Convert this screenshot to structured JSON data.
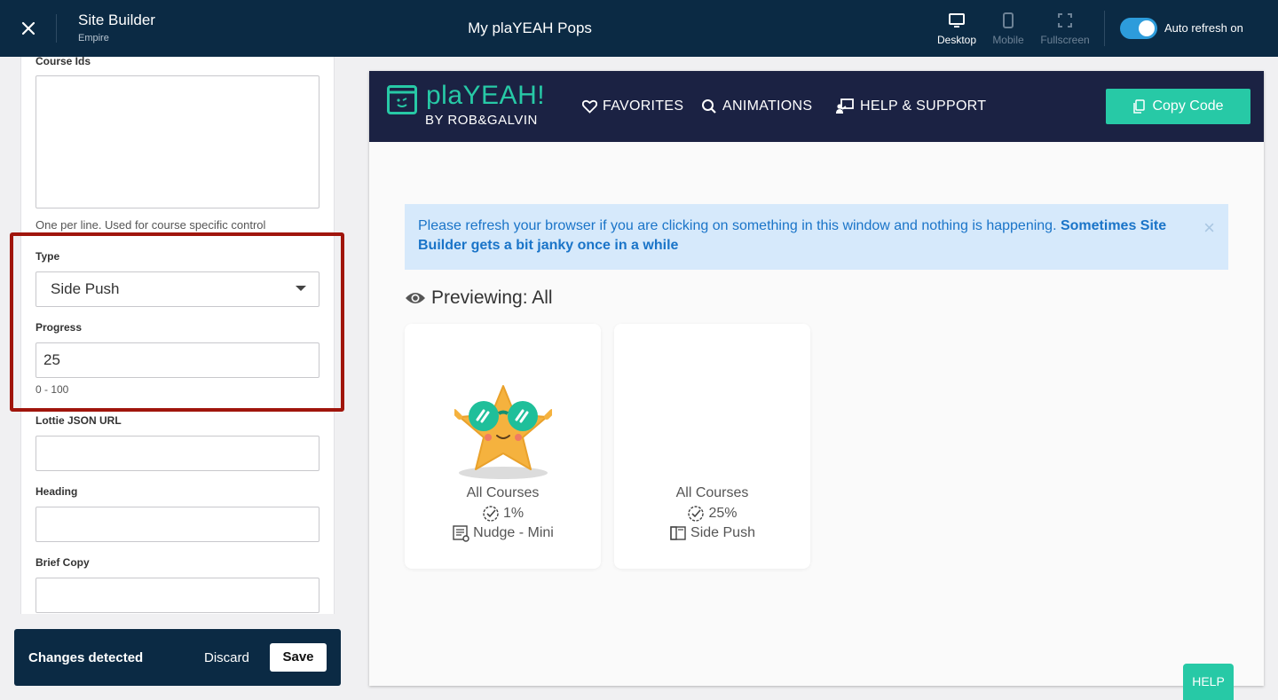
{
  "topbar": {
    "app_title": "Site Builder",
    "app_subtitle": "Empire",
    "page_name": "My plaYEAH Pops",
    "views": [
      {
        "label": "Desktop",
        "icon": "desktop-icon",
        "state": "active"
      },
      {
        "label": "Mobile",
        "icon": "mobile-icon",
        "state": "disabled"
      },
      {
        "label": "Fullscreen",
        "icon": "fullscreen-icon",
        "state": "disabled"
      }
    ],
    "auto_refresh_label": "Auto refresh on",
    "auto_refresh_on": true
  },
  "form": {
    "course_ids": {
      "label": "Course Ids",
      "value": "",
      "help": "One per line. Used for course specific control"
    },
    "type": {
      "label": "Type",
      "value": "Side Push"
    },
    "progress": {
      "label": "Progress",
      "value": "25",
      "help": "0 - 100"
    },
    "lottie": {
      "label": "Lottie JSON URL",
      "value": ""
    },
    "heading": {
      "label": "Heading",
      "value": ""
    },
    "brief_copy": {
      "label": "Brief Copy",
      "value": ""
    }
  },
  "changes_bar": {
    "text": "Changes detected",
    "discard": "Discard",
    "save": "Save"
  },
  "preview": {
    "logo_text": "plaYEAH!",
    "logo_sub": "BY ROB&GALVIN",
    "nav": [
      {
        "label": "FAVORITES",
        "icon": "heart-icon"
      },
      {
        "label": "ANIMATIONS",
        "icon": "search-icon"
      },
      {
        "label": "HELP & SUPPORT",
        "icon": "support-icon"
      }
    ],
    "copy_code": "Copy Code",
    "alert_text": "Please refresh your browser if you are clicking on something in this window and nothing is happening. ",
    "alert_bold": "Sometimes Site Builder gets a bit janky once in a while",
    "alert_close": "×",
    "previewing": "Previewing: All",
    "cards": [
      {
        "courses": "All Courses",
        "progress": "1%",
        "type": "Nudge - Mini",
        "image": "star-with-sunglasses"
      },
      {
        "courses": "All Courses",
        "progress": "25%",
        "type": "Side Push",
        "image": ""
      }
    ]
  },
  "help_button": "HELP",
  "colors": {
    "topbar": "#0b2a44",
    "accent_teal": "#27c9a6",
    "preview_nav": "#1b2243",
    "highlight": "#a0150c",
    "toggle": "#2d9cdb",
    "alert_bg": "#d6e9fb",
    "alert_text": "#1a74c8"
  }
}
